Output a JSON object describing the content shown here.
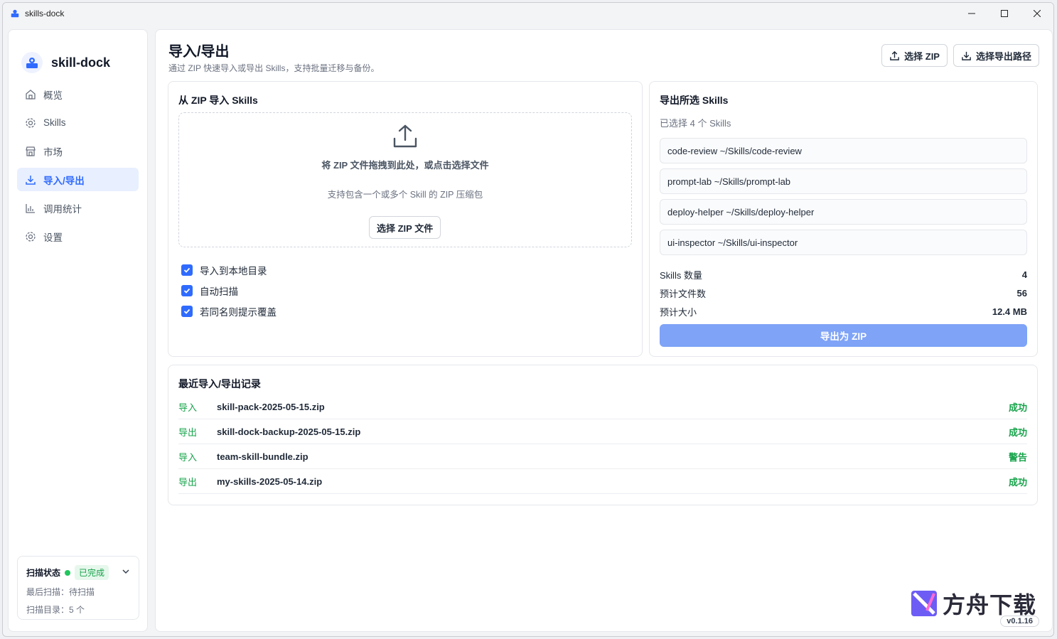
{
  "window": {
    "title": "skills-dock"
  },
  "sidebar": {
    "brand": "skill-dock",
    "items": [
      {
        "label": "概览",
        "icon": "home-icon",
        "active": false
      },
      {
        "label": "Skills",
        "icon": "gear-icon",
        "active": false
      },
      {
        "label": "市场",
        "icon": "store-icon",
        "active": false
      },
      {
        "label": "导入/导出",
        "icon": "download-icon",
        "active": true
      },
      {
        "label": "调用统计",
        "icon": "bar-chart-icon",
        "active": false
      },
      {
        "label": "设置",
        "icon": "settings-icon",
        "active": false
      }
    ],
    "scan": {
      "label": "扫描状态",
      "status": "已完成",
      "last_scan": "最后扫描：待扫描",
      "dirs": "扫描目录：5 个"
    }
  },
  "header": {
    "title": "导入/导出",
    "subtitle": "通过 ZIP 快速导入或导出 Skills，支持批量迁移与备份。",
    "select_zip": "选择 ZIP",
    "select_export_path": "选择导出路径"
  },
  "import": {
    "title": "从 ZIP 导入 Skills",
    "drop_main": "将 ZIP 文件拖拽到此处，或点击选择文件",
    "drop_sub": "支持包含一个或多个 Skill 的 ZIP 压缩包",
    "choose_button": "选择 ZIP 文件",
    "options": [
      {
        "label": "导入到本地目录",
        "checked": true
      },
      {
        "label": "自动扫描",
        "checked": true
      },
      {
        "label": "若同名则提示覆盖",
        "checked": true
      }
    ]
  },
  "export": {
    "title": "导出所选 Skills",
    "selected": "已选择 4 个 Skills",
    "skills": [
      "code-review ~/Skills/code-review",
      "prompt-lab ~/Skills/prompt-lab",
      "deploy-helper ~/Skills/deploy-helper",
      "ui-inspector ~/Skills/ui-inspector"
    ],
    "stats": [
      {
        "label": "Skills 数量",
        "value": "4"
      },
      {
        "label": "预计文件数",
        "value": "56"
      },
      {
        "label": "预计大小",
        "value": "12.4 MB"
      }
    ],
    "button": "导出为 ZIP"
  },
  "history": {
    "title": "最近导入/导出记录",
    "rows": [
      {
        "type": "导入",
        "file": "skill-pack-2025-05-15.zip",
        "status": "成功"
      },
      {
        "type": "导出",
        "file": "skill-dock-backup-2025-05-15.zip",
        "status": "成功"
      },
      {
        "type": "导入",
        "file": "team-skill-bundle.zip",
        "status": "警告"
      },
      {
        "type": "导出",
        "file": "my-skills-2025-05-14.zip",
        "status": "成功"
      }
    ]
  },
  "watermark": {
    "text": "方舟下载"
  },
  "version": "v0.1.16",
  "colors": {
    "accent": "#2f6bff",
    "success": "#16a34a",
    "export_button": "#7ea3f7"
  }
}
